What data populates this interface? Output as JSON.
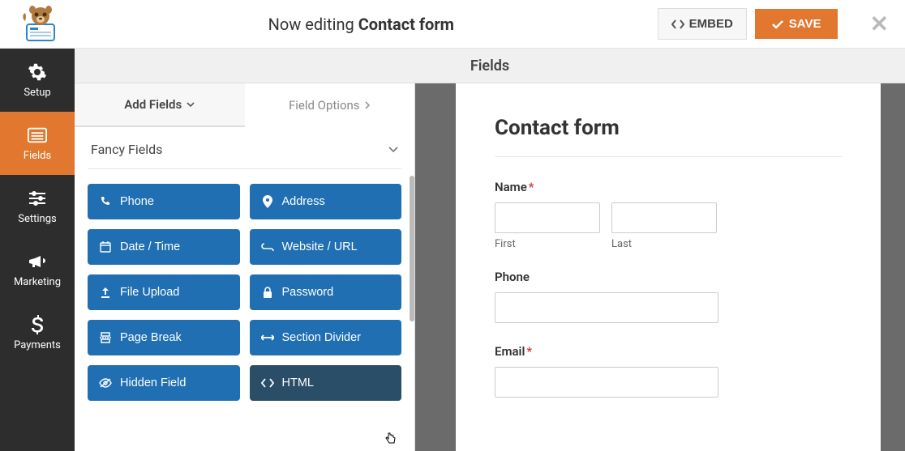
{
  "header": {
    "editing_prefix": "Now editing ",
    "editing_title": "Contact form",
    "embed_label": "EMBED",
    "save_label": "SAVE"
  },
  "sidebar": {
    "items": [
      {
        "label": "Setup"
      },
      {
        "label": "Fields"
      },
      {
        "label": "Settings"
      },
      {
        "label": "Marketing"
      },
      {
        "label": "Payments"
      }
    ]
  },
  "section_title": "Fields",
  "tabs": {
    "add_fields": "Add Fields",
    "field_options": "Field Options"
  },
  "group_title": "Fancy Fields",
  "fields": [
    {
      "label": "Phone"
    },
    {
      "label": "Address"
    },
    {
      "label": "Date / Time"
    },
    {
      "label": "Website / URL"
    },
    {
      "label": "File Upload"
    },
    {
      "label": "Password"
    },
    {
      "label": "Page Break"
    },
    {
      "label": "Section Divider"
    },
    {
      "label": "Hidden Field"
    },
    {
      "label": "HTML"
    }
  ],
  "preview": {
    "title": "Contact form",
    "name_label": "Name",
    "first_label": "First",
    "last_label": "Last",
    "phone_label": "Phone",
    "email_label": "Email",
    "required_marker": "*"
  }
}
